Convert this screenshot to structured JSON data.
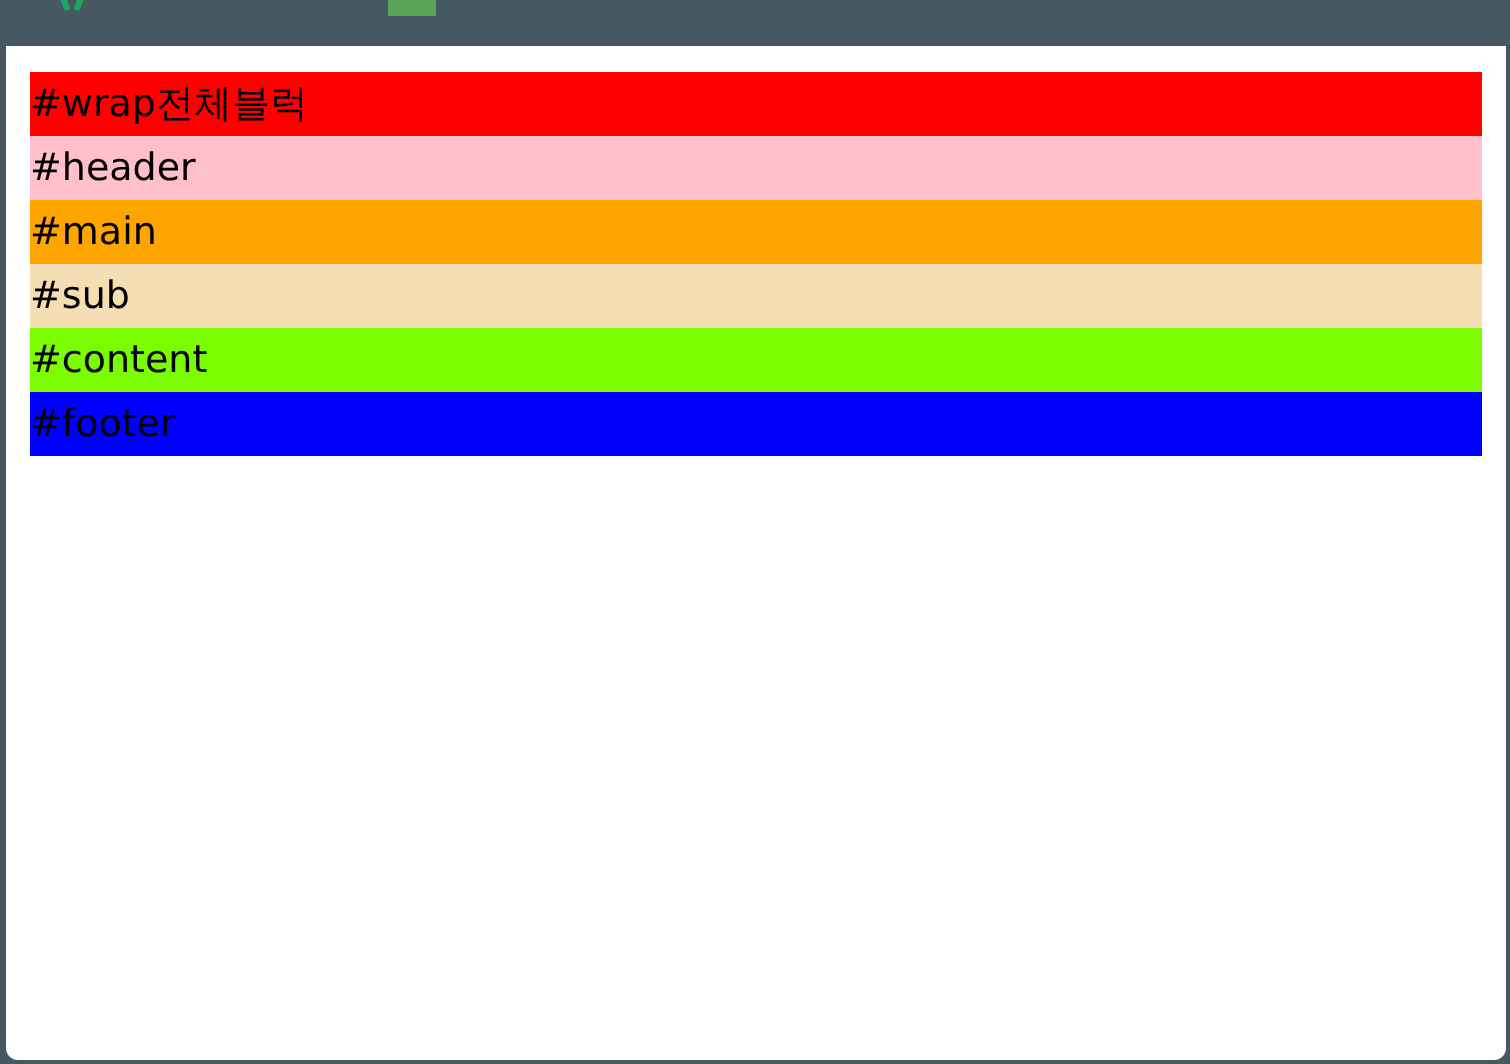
{
  "blocks": [
    {
      "label": "#wrap전체블럭",
      "color": "#ff0000"
    },
    {
      "label": "#header",
      "color": "#ffc0cb"
    },
    {
      "label": "#main",
      "color": "#ffa500"
    },
    {
      "label": "#sub",
      "color": "#f5deb3"
    },
    {
      "label": "#content",
      "color": "#7cfc00"
    },
    {
      "label": "#footer",
      "color": "#0000ff"
    }
  ]
}
